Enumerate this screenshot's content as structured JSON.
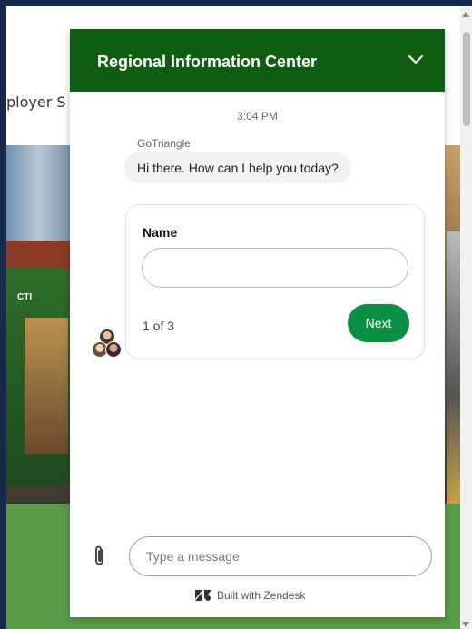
{
  "background_site": {
    "nav_fragment": "ployer S"
  },
  "chat": {
    "header": {
      "title": "Regional Information Center",
      "collapse_icon": "chevron-down-icon"
    },
    "timestamp": "3:04 PM",
    "sender": "GoTriangle",
    "greeting": "Hi there. How can I help you today?",
    "form": {
      "field_label": "Name",
      "field_value": "",
      "step": "1 of 3",
      "next_label": "Next"
    },
    "composer": {
      "placeholder": "Type a message",
      "attach_icon": "paperclip-icon"
    },
    "footer": "Built with Zendesk"
  },
  "colors": {
    "header_green": "#0f5d12",
    "next_button_green": "#0b8f45"
  }
}
